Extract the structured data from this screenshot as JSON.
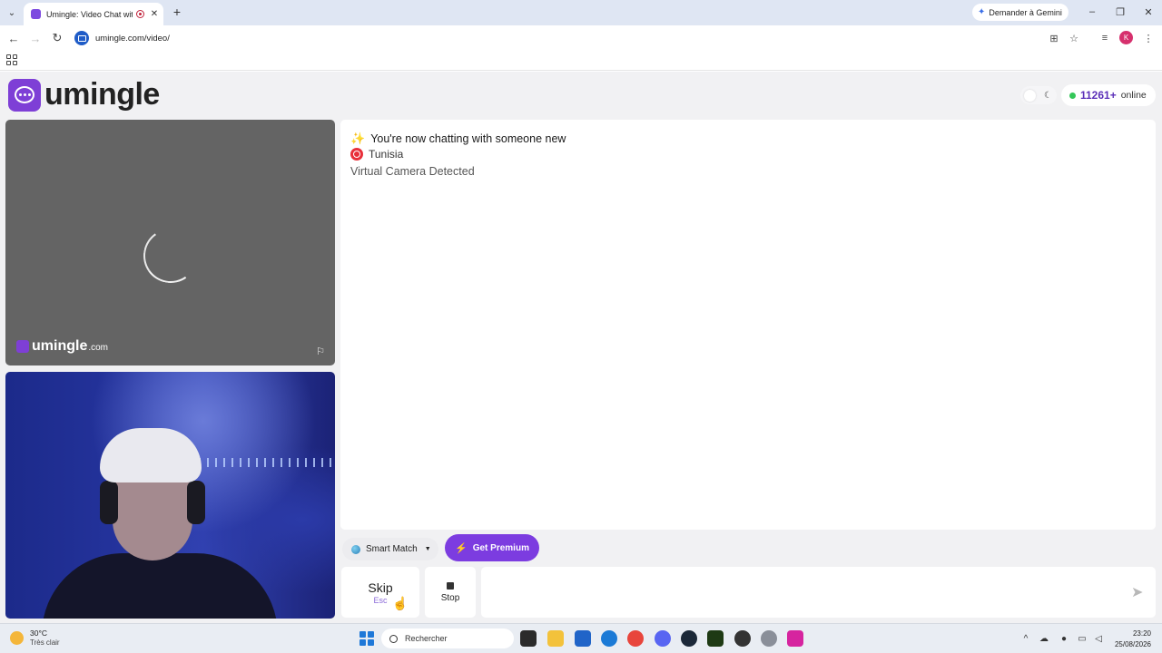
{
  "browser": {
    "tab_title": "Umingle: Video Chat with S",
    "gemini_label": "Demander à Gemini",
    "url": "umingle.com/video/",
    "profile_initial": "K"
  },
  "header": {
    "logo_text": "umingle",
    "online_count": "11261+",
    "online_label": "online"
  },
  "remote_video": {
    "watermark": "umingle",
    "watermark_suffix": ".com"
  },
  "chat": {
    "status_message": "You're now chatting with someone new",
    "country": "Tunisia",
    "notice": "Virtual Camera Detected"
  },
  "controls": {
    "match_mode": "Smart Match",
    "premium_label": "Get Premium",
    "skip_label": "Skip",
    "skip_key": "Esc",
    "stop_label": "Stop",
    "message_placeholder": ""
  },
  "taskbar": {
    "weather_temp": "30°C",
    "weather_desc": "Très clair",
    "search_placeholder": "Rechercher",
    "time": "23:20",
    "date": "25/08/2026"
  },
  "colors": {
    "brand": "#7e3fd6",
    "premium": "#7c3ce0",
    "online_dot": "#34c759"
  }
}
